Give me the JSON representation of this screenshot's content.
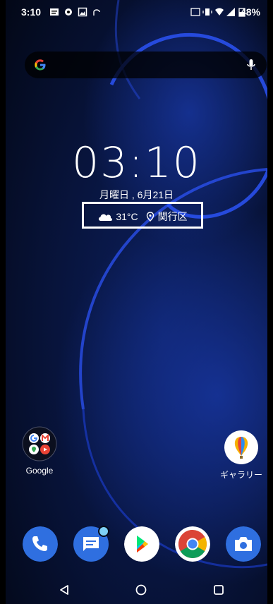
{
  "status_bar": {
    "time": "3:10",
    "battery": "48%",
    "icons": [
      "message-icon",
      "settings-gear-icon",
      "image-icon",
      "signal-search-icon",
      "nfc-icon",
      "vibrate-icon",
      "wifi-icon",
      "cell-signal-icon",
      "battery-icon"
    ]
  },
  "search": {
    "logo": "google-g-icon",
    "mic": "mic-icon"
  },
  "clock_widget": {
    "time": "03:10",
    "date": "月曜日 , 6月21日",
    "temperature": "31°C",
    "location": "関行区",
    "weather_icon": "cloud-icon",
    "location_icon": "location-pin-icon"
  },
  "home_apps": [
    {
      "label": "Google",
      "icon": "google-folder-icon"
    },
    {
      "label": "ギャラリー",
      "icon": "gallery-balloon-icon"
    }
  ],
  "dock": [
    {
      "icon": "phone-icon",
      "color": "#2f6fe0"
    },
    {
      "icon": "messages-icon",
      "color": "#2f6fe0"
    },
    {
      "icon": "play-store-icon",
      "color": "#ffffff"
    },
    {
      "icon": "chrome-icon",
      "color": "#ffffff"
    },
    {
      "icon": "camera-icon",
      "color": "#2f6fe0"
    }
  ],
  "nav_bar": {
    "back": "back-icon",
    "home": "home-icon",
    "recents": "recents-icon"
  }
}
